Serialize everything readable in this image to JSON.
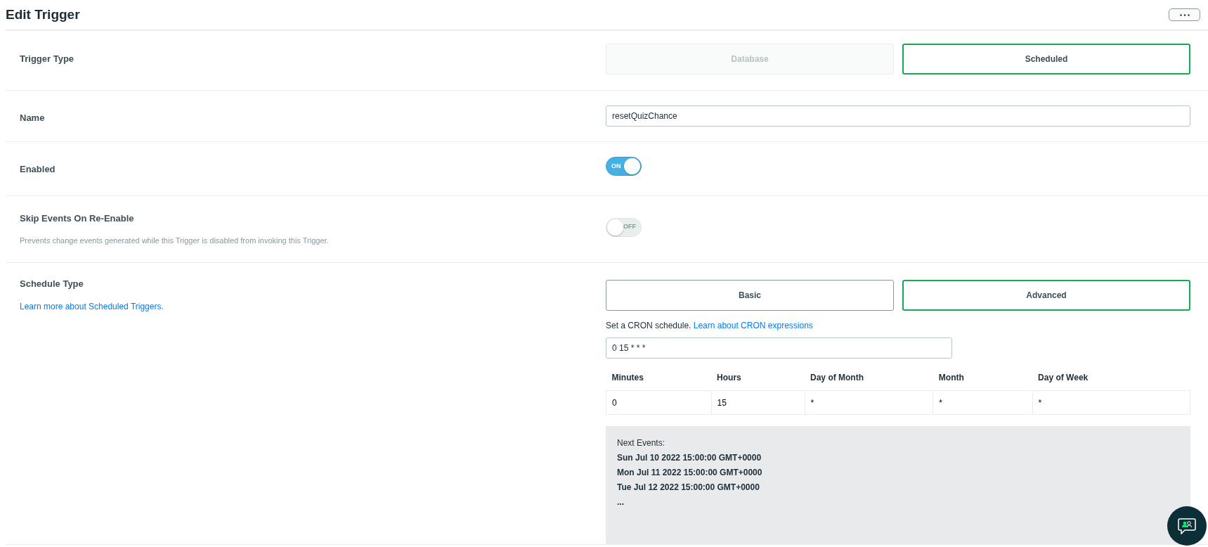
{
  "header": {
    "title": "Edit Trigger"
  },
  "trigger_type": {
    "label": "Trigger Type",
    "options": [
      {
        "label": "Database",
        "selected": false,
        "disabled": true
      },
      {
        "label": "Scheduled",
        "selected": true,
        "disabled": false
      }
    ]
  },
  "name": {
    "label": "Name",
    "value": "resetQuizChance"
  },
  "enabled": {
    "label": "Enabled",
    "on": true,
    "state_label": "ON"
  },
  "skip_events": {
    "label": "Skip Events On Re-Enable",
    "description": "Prevents change events generated while this Trigger is disabled from invoking this Trigger.",
    "on": false,
    "state_label": "OFF"
  },
  "schedule_type": {
    "label": "Schedule Type",
    "link": "Learn more about Scheduled Triggers.",
    "options": [
      {
        "label": "Basic",
        "selected": false
      },
      {
        "label": "Advanced",
        "selected": true
      }
    ],
    "hint": "Set a CRON schedule.",
    "hint_link": "Learn about CRON expressions",
    "cron": "0 15 * * *",
    "table": {
      "columns": [
        "Minutes",
        "Hours",
        "Day of Month",
        "Month",
        "Day of Week"
      ],
      "values": [
        "0",
        "15",
        "*",
        "*",
        "*"
      ]
    },
    "next_events": {
      "label": "Next Events:",
      "events": [
        "Sun Jul 10 2022 15:00:00 GMT+0000",
        "Mon Jul 11 2022 15:00:00 GMT+0000",
        "Tue Jul 12 2022 15:00:00 GMT+0000"
      ],
      "more": "..."
    }
  }
}
